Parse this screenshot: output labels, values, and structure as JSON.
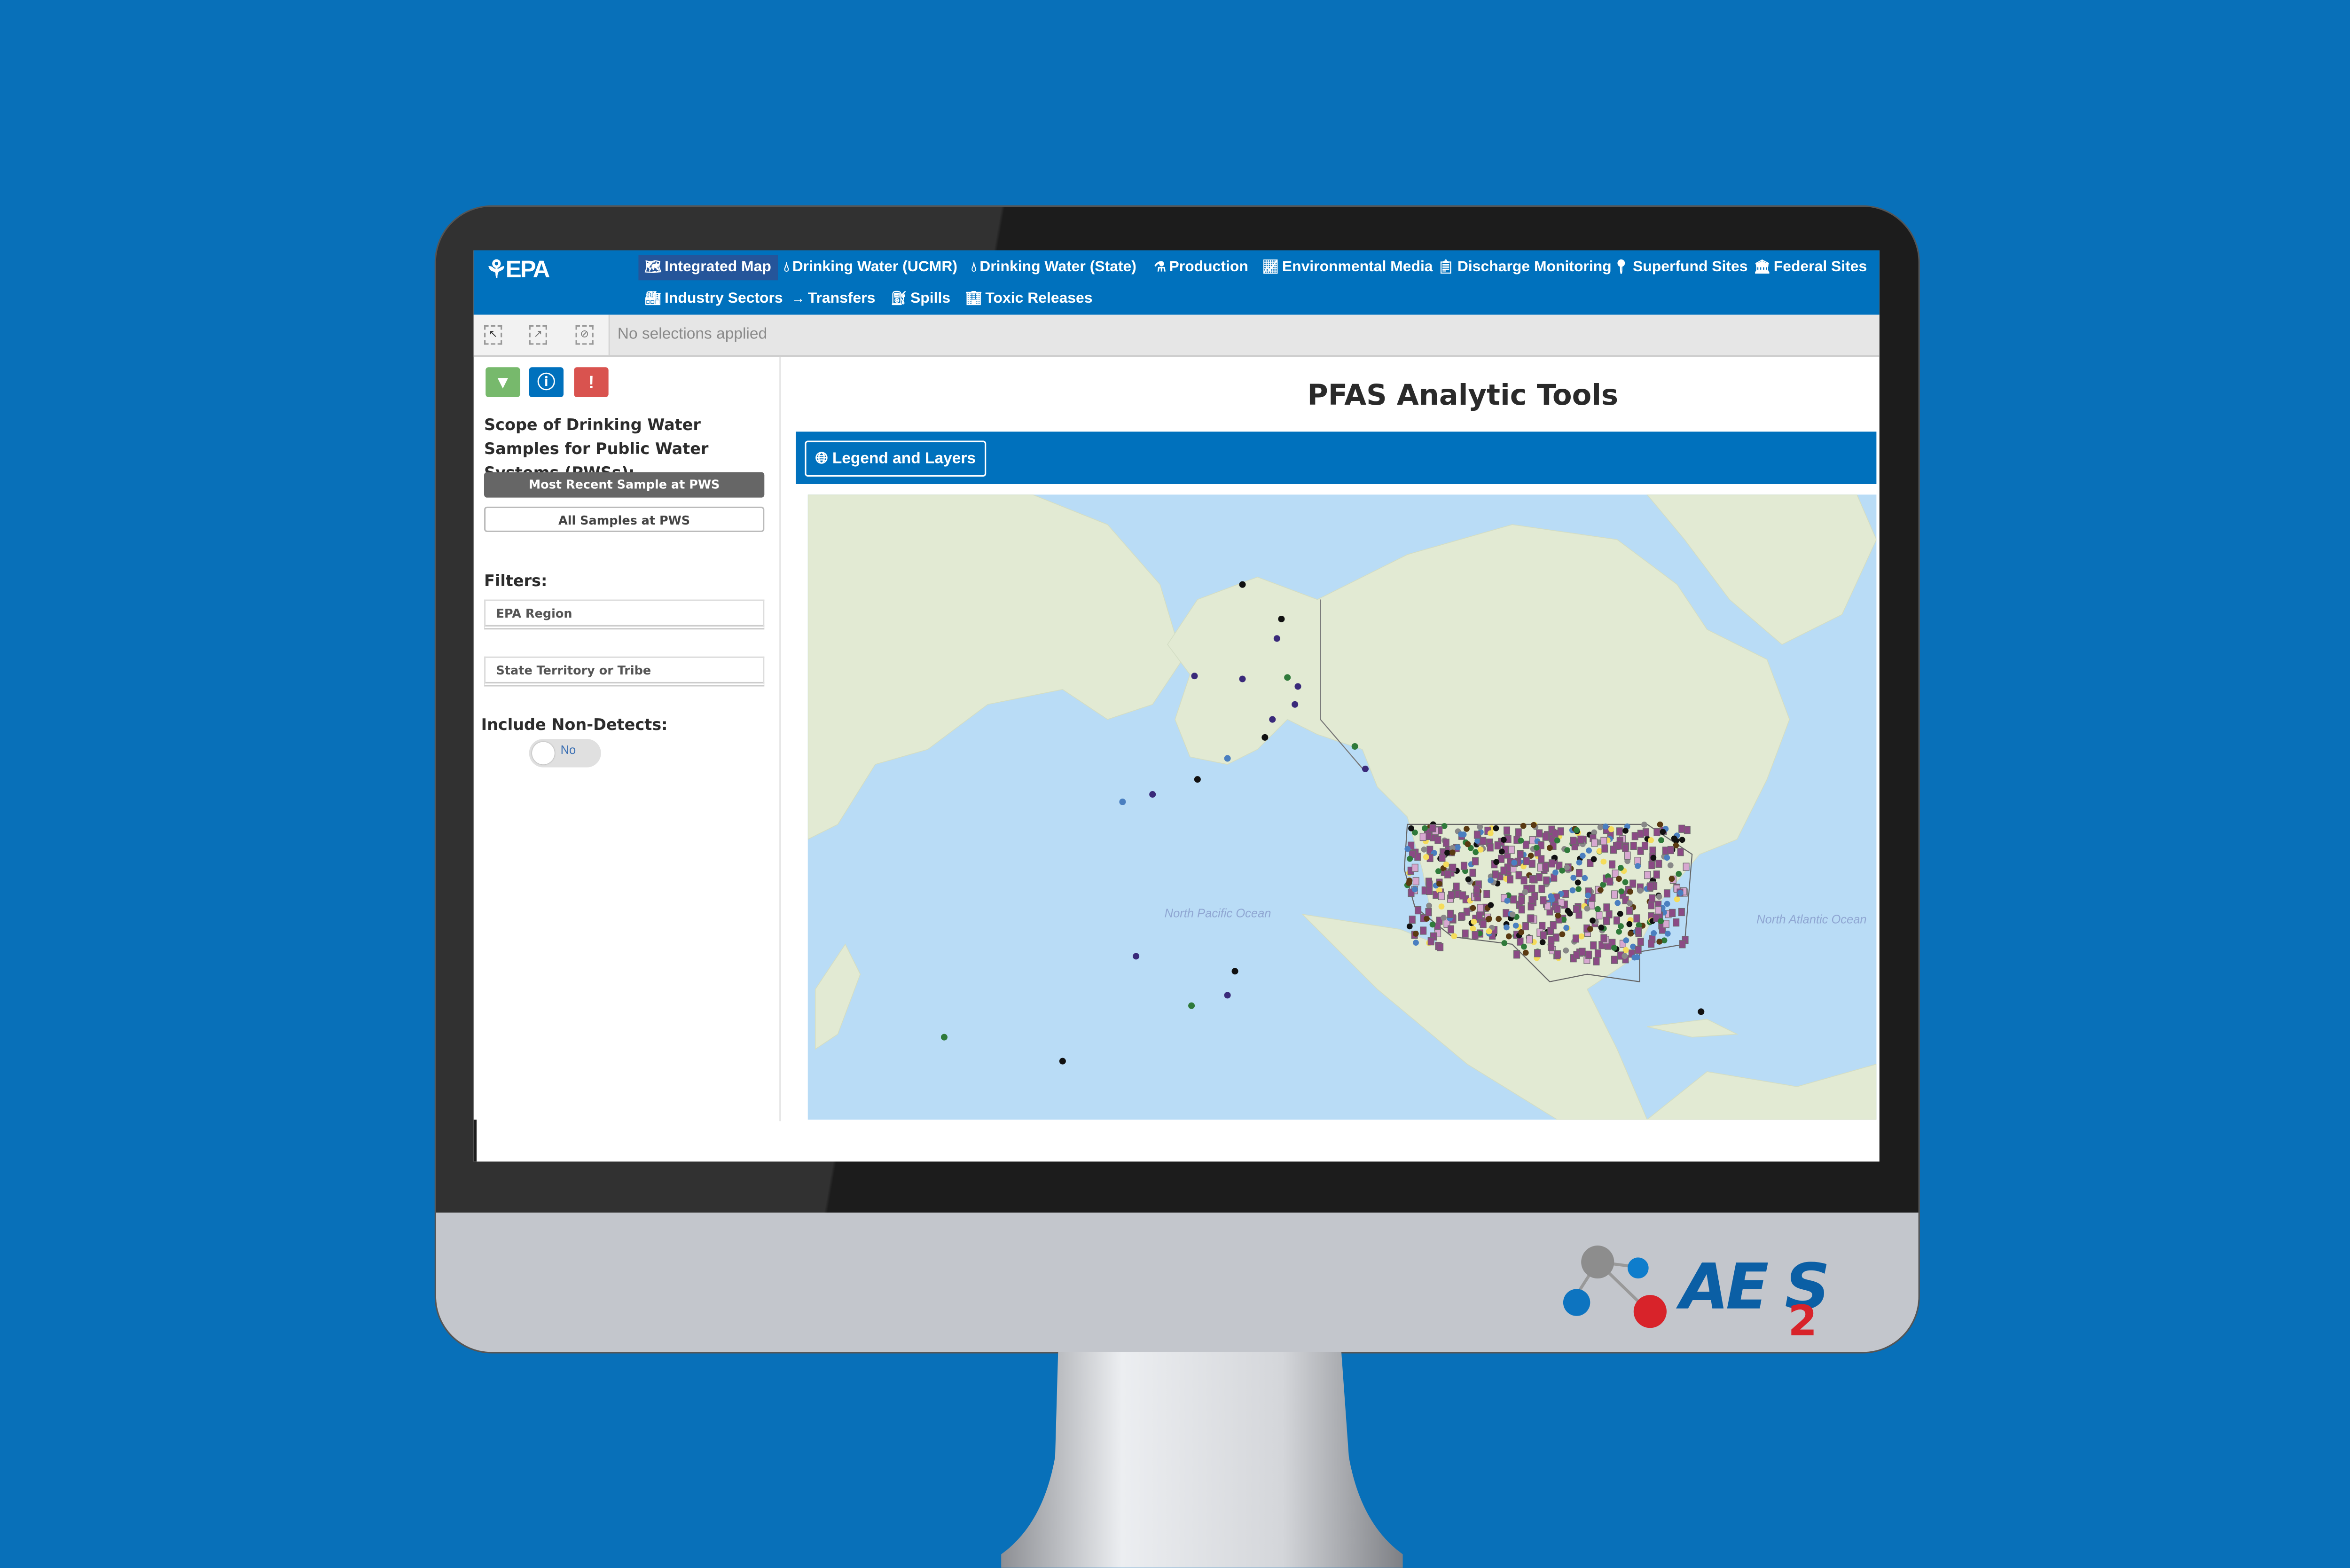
{
  "app": {
    "logo": "EPA",
    "nav": {
      "row1": [
        {
          "label": "Integrated Map",
          "icon": "map-icon",
          "active": true
        },
        {
          "label": "Drinking Water (UCMR)",
          "icon": "droplet-icon"
        },
        {
          "label": "Drinking Water (State)",
          "icon": "droplet-icon"
        },
        {
          "label": "Production",
          "icon": "flask-icon"
        },
        {
          "label": "Environmental Media",
          "icon": "chart-icon"
        },
        {
          "label": "Discharge Monitoring",
          "icon": "clipboard-icon"
        },
        {
          "label": "Superfund Sites",
          "icon": "map-marker-icon"
        },
        {
          "label": "Federal Sites",
          "icon": "building-columns-icon"
        }
      ],
      "row2": [
        {
          "label": "Industry Sectors",
          "icon": "industry-icon"
        },
        {
          "label": "Transfers",
          "icon": "arrow-right-icon"
        },
        {
          "label": "Spills",
          "icon": "spill-icon"
        },
        {
          "label": "Toxic Releases",
          "icon": "factory-icon"
        }
      ]
    },
    "toolbar": {
      "selections_status": "No selections applied"
    },
    "sidebar": {
      "icon_buttons": [
        {
          "icon": "filter-icon",
          "color": "#77b96c"
        },
        {
          "icon": "info-icon",
          "color": "#0071bd"
        },
        {
          "icon": "alert-icon",
          "color": "#d9534f"
        }
      ],
      "scope_heading": "Scope of Drinking Water Samples for Public Water Systems (PWSs):",
      "scope_options": [
        {
          "label": "Most Recent Sample at PWS",
          "selected": true
        },
        {
          "label": "All Samples at PWS",
          "selected": false
        }
      ],
      "filters_heading": "Filters:",
      "filters": [
        {
          "label": "EPA Region"
        },
        {
          "label": "State Territory or Tribe"
        }
      ],
      "nondetects_heading": "Include Non-Detects:",
      "nondetects_value": "No"
    },
    "main": {
      "title": "PFAS Analytic Tools",
      "legend_button": "Legend and Layers",
      "map": {
        "ocean_labels": [
          "North Pacific Ocean",
          "North Atlantic Ocean"
        ],
        "colors": {
          "ocean": "#b9dcf6",
          "land": "#e2ead3",
          "primary_marker": "#8b4a85"
        }
      }
    }
  },
  "brand": {
    "logo_text": "AES",
    "logo_subscript": "2",
    "colors": {
      "background": "#0870b9",
      "logo_blue": "#0b5fa5",
      "logo_red": "#d8232a"
    }
  }
}
